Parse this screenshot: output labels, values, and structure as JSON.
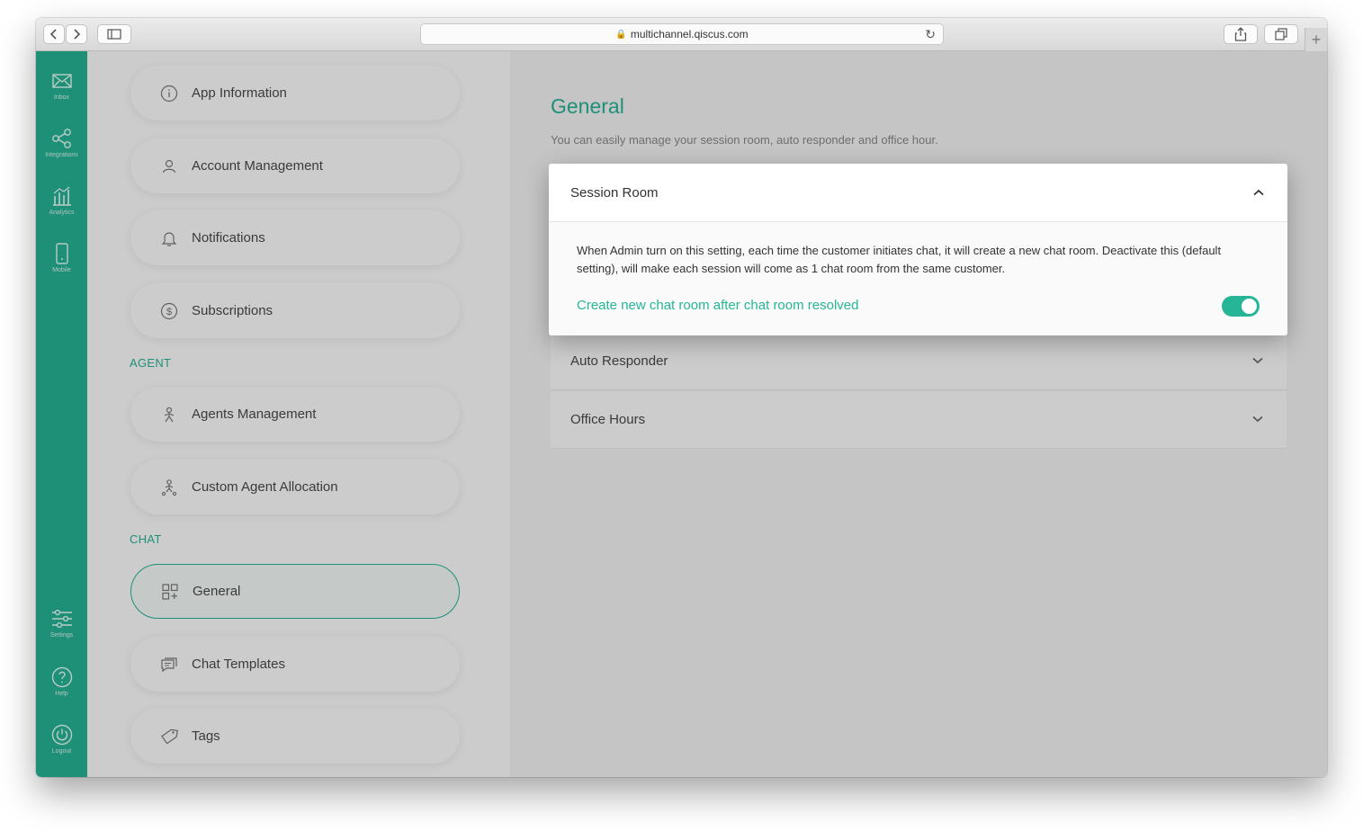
{
  "browser": {
    "url": "multichannel.qiscus.com",
    "plus": "+"
  },
  "rail": {
    "inbox": "Inbox",
    "integrations": "Integrations",
    "analytics": "Analytics",
    "mobile": "Mobile",
    "settings": "Settings",
    "help": "Help",
    "logout": "Logout"
  },
  "settings_nav": {
    "items_top": [
      {
        "label": "App Information",
        "icon": "info-icon"
      },
      {
        "label": "Account Management",
        "icon": "user-icon"
      },
      {
        "label": "Notifications",
        "icon": "bell-icon"
      },
      {
        "label": "Subscriptions",
        "icon": "dollar-icon"
      }
    ],
    "agent_section": "AGENT",
    "items_agent": [
      {
        "label": "Agents Management",
        "icon": "agent-icon"
      },
      {
        "label": "Custom Agent Allocation",
        "icon": "allocation-icon"
      }
    ],
    "chat_section": "CHAT",
    "items_chat": [
      {
        "label": "General",
        "icon": "grid-plus-icon",
        "active": true
      },
      {
        "label": "Chat Templates",
        "icon": "template-icon"
      },
      {
        "label": "Tags",
        "icon": "tag-icon"
      }
    ]
  },
  "main": {
    "title": "General",
    "subtitle": "You can easily manage your session room, auto responder and office hour.",
    "accordions": [
      "Auto Responder",
      "Office Hours"
    ]
  },
  "modal": {
    "title": "Session Room",
    "description": "When Admin turn on this setting, each time the customer initiates chat, it will create a new chat room. Deactivate this (default setting), will make each session will come as 1 chat room from the same customer.",
    "option_label": "Create new chat room after chat room resolved",
    "toggle_on": true
  },
  "colors": {
    "accent": "#27b597"
  }
}
